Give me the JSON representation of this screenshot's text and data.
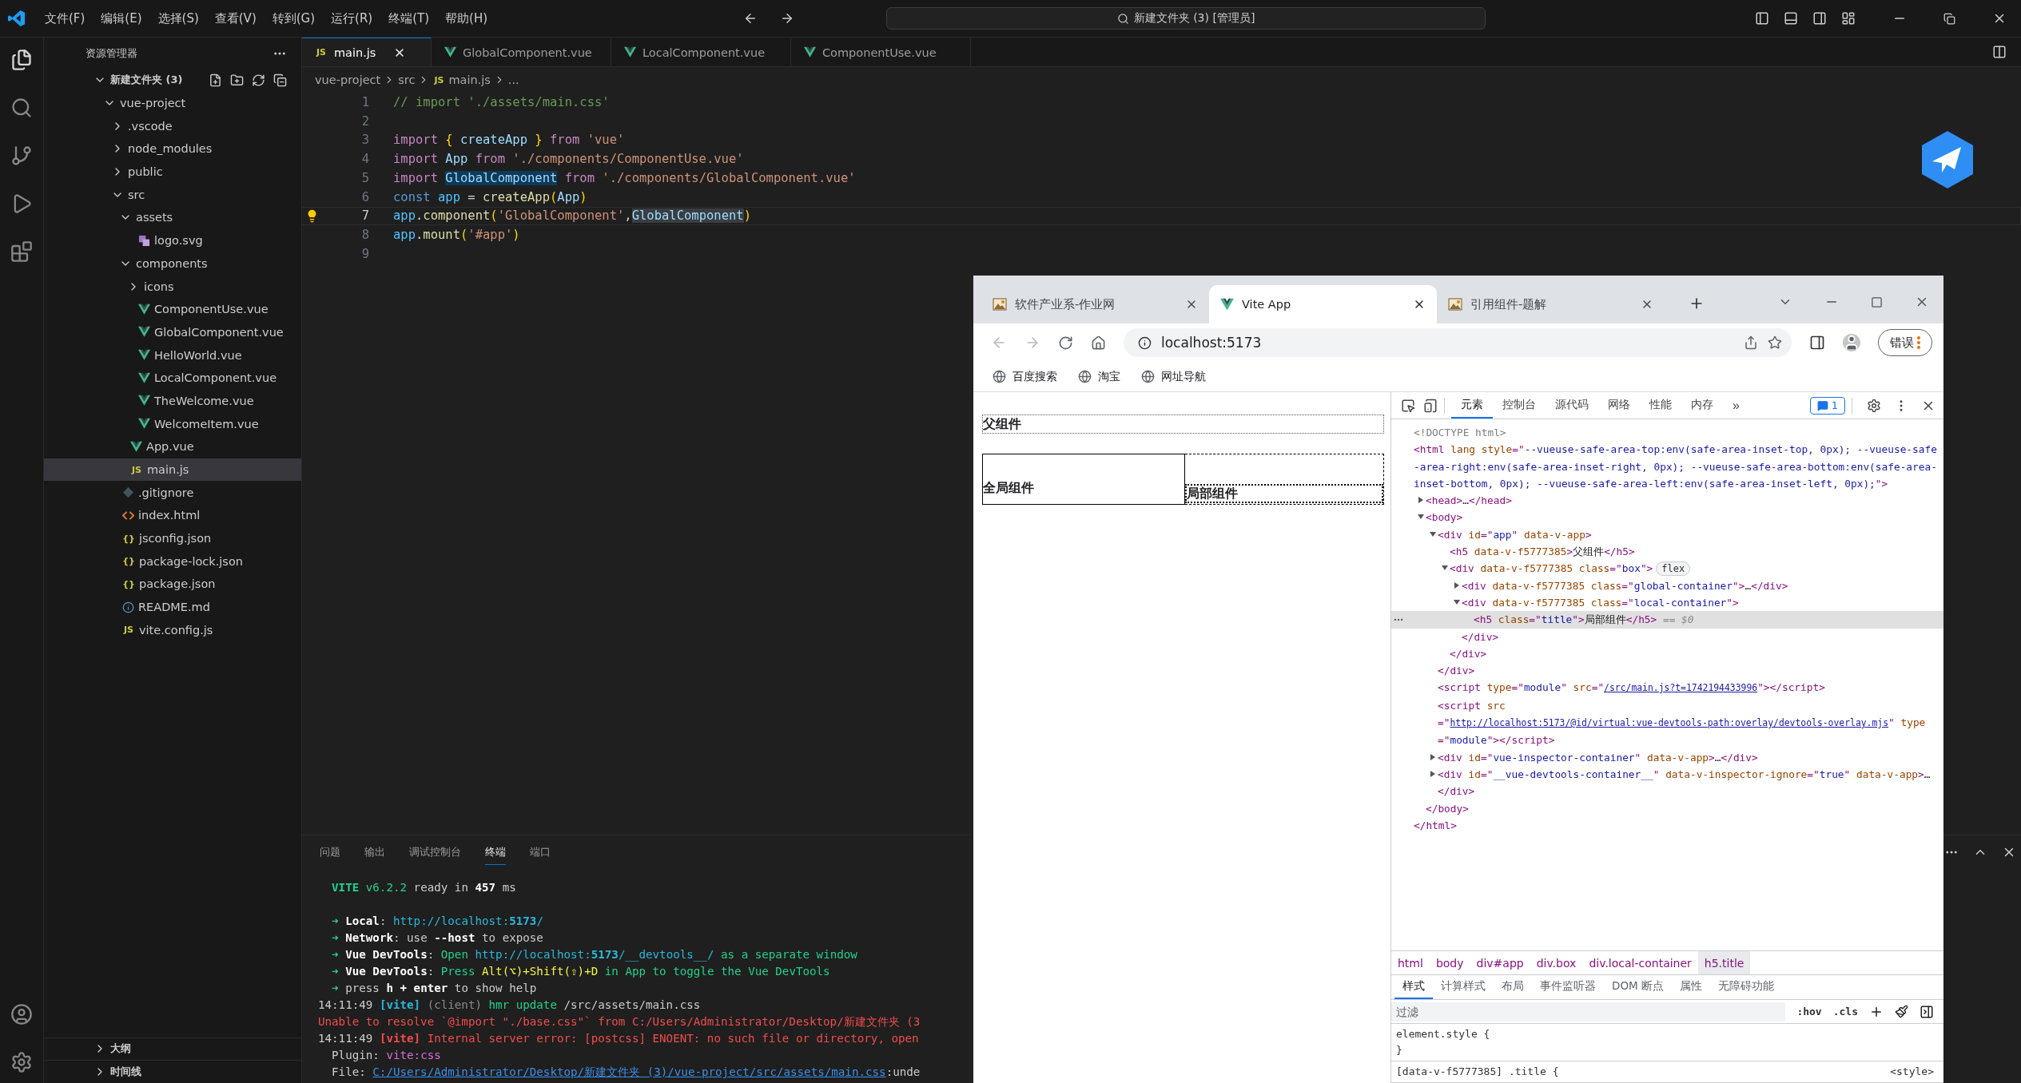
{
  "menu_bar": {
    "items": [
      "文件(F)",
      "编辑(E)",
      "选择(S)",
      "查看(V)",
      "转到(G)",
      "运行(R)",
      "终端(T)",
      "帮助(H)"
    ],
    "search": "新建文件夹 (3) [管理员]"
  },
  "explorer": {
    "title": "资源管理器",
    "section": {
      "label": "新建文件夹 (3)",
      "expanded": true
    },
    "tree": [
      {
        "label": "vue-project",
        "kind": "folder",
        "expanded": true,
        "selected": false,
        "children": [
          {
            "label": ".vscode",
            "kind": "folder",
            "expanded": false,
            "selected": false
          },
          {
            "label": "node_modules",
            "kind": "folder",
            "expanded": false,
            "selected": false
          },
          {
            "label": "public",
            "kind": "folder",
            "expanded": false,
            "selected": false
          },
          {
            "label": "src",
            "kind": "folder",
            "expanded": true,
            "selected": false,
            "children": [
              {
                "label": "assets",
                "kind": "folder",
                "expanded": true,
                "selected": false,
                "children": [
                  {
                    "label": "logo.svg",
                    "kind": "svg",
                    "selected": false
                  }
                ]
              },
              {
                "label": "components",
                "kind": "folder",
                "expanded": true,
                "selected": false,
                "children": [
                  {
                    "label": "icons",
                    "kind": "folder",
                    "expanded": false,
                    "selected": false
                  },
                  {
                    "label": "ComponentUse.vue",
                    "kind": "vue",
                    "selected": false
                  },
                  {
                    "label": "GlobalComponent.vue",
                    "kind": "vue",
                    "selected": false
                  },
                  {
                    "label": "HelloWorld.vue",
                    "kind": "vue",
                    "selected": false
                  },
                  {
                    "label": "LocalComponent.vue",
                    "kind": "vue",
                    "selected": false
                  },
                  {
                    "label": "TheWelcome.vue",
                    "kind": "vue",
                    "selected": false
                  },
                  {
                    "label": "WelcomeItem.vue",
                    "kind": "vue",
                    "selected": false
                  }
                ]
              },
              {
                "label": "App.vue",
                "kind": "vue",
                "selected": false
              },
              {
                "label": "main.js",
                "kind": "js",
                "icon_text": "JS",
                "selected": true
              }
            ]
          },
          {
            "label": ".gitignore",
            "kind": "git",
            "selected": false
          },
          {
            "label": "index.html",
            "kind": "html",
            "selected": false
          },
          {
            "label": "jsconfig.json",
            "kind": "json",
            "icon_text": "{}",
            "selected": false
          },
          {
            "label": "package-lock.json",
            "kind": "json",
            "icon_text": "{}",
            "selected": false
          },
          {
            "label": "package.json",
            "kind": "json",
            "icon_text": "{}",
            "selected": false
          },
          {
            "label": "README.md",
            "kind": "info",
            "selected": false
          },
          {
            "label": "vite.config.js",
            "kind": "js",
            "icon_text": "JS",
            "selected": false
          }
        ]
      }
    ],
    "bottom_sections": [
      {
        "label": "大纲",
        "expanded": false
      },
      {
        "label": "时间线",
        "expanded": false
      }
    ]
  },
  "editor": {
    "tabs": [
      {
        "label": "main.js",
        "kind": "js",
        "icon_text": "JS",
        "selected": true
      },
      {
        "label": "GlobalComponent.vue",
        "kind": "vue",
        "selected": false
      },
      {
        "label": "LocalComponent.vue",
        "kind": "vue",
        "selected": false
      },
      {
        "label": "ComponentUse.vue",
        "kind": "vue",
        "selected": false
      }
    ],
    "breadcrumb": [
      {
        "label": "vue-project"
      },
      {
        "label": "src"
      },
      {
        "label": "main.js",
        "icon_text": "JS"
      },
      {
        "label": "..."
      }
    ],
    "lines": [
      {
        "number": "1",
        "current": false,
        "tokens": [
          {
            "kind": "comment",
            "text": "// import './assets/main.css'"
          }
        ]
      },
      {
        "number": "2",
        "current": false
      },
      {
        "number": "3",
        "current": false,
        "tokens": [
          {
            "kind": "keyword",
            "text": "import "
          },
          {
            "kind": "bracket",
            "text": "{"
          },
          {
            "kind": "var",
            "text": " createApp "
          },
          {
            "kind": "bracket",
            "text": "}"
          },
          {
            "kind": "keyword",
            "text": " from "
          },
          {
            "kind": "string",
            "text": "'vue'"
          }
        ]
      },
      {
        "number": "4",
        "current": false,
        "tokens": [
          {
            "kind": "keyword",
            "text": "import "
          },
          {
            "kind": "var",
            "text": "App"
          },
          {
            "kind": "keyword",
            "text": " from "
          },
          {
            "kind": "string",
            "text": "'./components/ComponentUse.vue'"
          }
        ]
      },
      {
        "number": "5",
        "current": false,
        "tokens": [
          {
            "kind": "keyword",
            "text": "import "
          },
          {
            "kind": "var_match",
            "text": "GlobalComponent"
          },
          {
            "kind": "keyword",
            "text": " from "
          },
          {
            "kind": "string",
            "text": "'./components/GlobalComponent.vue'"
          }
        ]
      },
      {
        "number": "6",
        "current": false,
        "tokens": [
          {
            "kind": "storage",
            "text": "const "
          },
          {
            "kind": "const",
            "text": "app"
          },
          {
            "kind": "plain",
            "text": " = "
          },
          {
            "kind": "func",
            "text": "createApp"
          },
          {
            "kind": "bracket",
            "text": "("
          },
          {
            "kind": "var",
            "text": "App"
          },
          {
            "kind": "bracket",
            "text": ")"
          }
        ]
      },
      {
        "number": "7",
        "current": true,
        "tokens": [
          {
            "kind": "const",
            "text": "app"
          },
          {
            "kind": "plain",
            "text": "."
          },
          {
            "kind": "func",
            "text": "component"
          },
          {
            "kind": "bracket",
            "text": "("
          },
          {
            "kind": "string",
            "text": "'GlobalComponent'"
          },
          {
            "kind": "plain",
            "text": ","
          },
          {
            "kind": "var_selected",
            "text": "GlobalComponent"
          },
          {
            "kind": "bracket",
            "text": ")"
          }
        ]
      },
      {
        "number": "8",
        "current": false,
        "tokens": [
          {
            "kind": "const",
            "text": "app"
          },
          {
            "kind": "plain",
            "text": "."
          },
          {
            "kind": "func",
            "text": "mount"
          },
          {
            "kind": "bracket",
            "text": "("
          },
          {
            "kind": "string",
            "text": "'#app'"
          },
          {
            "kind": "bracket",
            "text": ")"
          }
        ]
      },
      {
        "number": "9",
        "current": false
      }
    ]
  },
  "panel": {
    "tabs": [
      {
        "label": "问题",
        "selected": false
      },
      {
        "label": "输出",
        "selected": false
      },
      {
        "label": "调试控制台",
        "selected": false
      },
      {
        "label": "终端",
        "selected": true
      },
      {
        "label": "端口",
        "selected": false
      }
    ],
    "terminal": [
      [
        {
          "indented": true,
          "tokens": [
            {
              "kind": "title",
              "text": "VITE"
            },
            {
              "kind": "green",
              "text": " v6.2.2"
            },
            {
              "kind": "plain",
              "text": "  ready in "
            },
            {
              "kind": "bold",
              "text": "457"
            },
            {
              "kind": "plain",
              "text": " ms"
            }
          ]
        }
      ],
      [
        {
          "indented": true,
          "tokens": [
            {
              "kind": "arrow",
              "text": "➜  "
            },
            {
              "kind": "bold",
              "text": "Local"
            },
            {
              "kind": "plain",
              "text": ":   "
            },
            {
              "kind": "link",
              "text": "http://localhost:**5173**/"
            }
          ]
        },
        {
          "indented": true,
          "tokens": [
            {
              "kind": "arrow",
              "text": "➜  "
            },
            {
              "kind": "bold",
              "text": "Network"
            },
            {
              "kind": "plain",
              "text": ": use "
            },
            {
              "kind": "bold",
              "text": "--host"
            },
            {
              "kind": "plain",
              "text": " to expose"
            }
          ]
        },
        {
          "indented": true,
          "tokens": [
            {
              "kind": "arrow",
              "text": "➜  "
            },
            {
              "kind": "bold",
              "text": "Vue DevTools"
            },
            {
              "kind": "plain",
              "text": ": "
            },
            {
              "kind": "green",
              "text": "Open "
            },
            {
              "kind": "link",
              "text": "http://localhost:**5173**/__devtools__/"
            },
            {
              "kind": "green",
              "text": " as a separate window"
            }
          ]
        },
        {
          "indented": true,
          "tokens": [
            {
              "kind": "arrow",
              "text": "➜  "
            },
            {
              "kind": "bold",
              "text": "Vue DevTools"
            },
            {
              "kind": "plain",
              "text": ": "
            },
            {
              "kind": "green",
              "text": "Press "
            },
            {
              "kind": "yellow",
              "text": "Alt(⌥)+Shift(⇧)+D"
            },
            {
              "kind": "green",
              "text": " in App to toggle the Vue DevTools"
            }
          ]
        },
        {
          "indented": true,
          "tokens": [
            {
              "kind": "arrow",
              "text": "➜  "
            },
            {
              "kind": "plain",
              "text": "press "
            },
            {
              "kind": "bold",
              "text": "h + enter"
            },
            {
              "kind": "plain",
              "text": " to show help"
            }
          ]
        },
        {
          "indented": false,
          "tokens": [
            {
              "kind": "plain",
              "text": "14:11:49 "
            },
            {
              "kind": "tag",
              "text": "[vite]"
            },
            {
              "kind": "muted",
              "text": " (client)"
            },
            {
              "kind": "green",
              "text": " hmr update "
            },
            {
              "kind": "plain",
              "text": "/src/assets/main.css"
            }
          ]
        },
        {
          "indented": false,
          "tokens": [
            {
              "kind": "error",
              "text": "Unable to resolve `@import \"./base.css\"` from C:/Users/Administrator/Desktop/新建文件夹 (3"
            }
          ]
        },
        {
          "indented": false,
          "tokens": [
            {
              "kind": "plain",
              "text": "14:11:49 "
            },
            {
              "kind": "error_tag",
              "text": "[vite]"
            },
            {
              "kind": "error",
              "text": " Internal server error: [postcss] ENOENT: no such file or directory, open"
            }
          ]
        },
        {
          "indented": true,
          "tokens": [
            {
              "kind": "plain",
              "text": "Plugin: "
            },
            {
              "kind": "purple",
              "text": "vite:css"
            }
          ]
        },
        {
          "indented": true,
          "tokens": [
            {
              "kind": "plain",
              "text": "File: "
            },
            {
              "kind": "path",
              "text": "C:/Users/Administrator/Desktop/新建文件夹 (3)/vue-project/src/assets/main.css"
            },
            {
              "kind": "plain",
              "text": ":unde"
            }
          ]
        }
      ]
    ]
  },
  "browser": {
    "tabs": [
      {
        "label": "软件产业系-作业网",
        "kind": "image",
        "selected": false
      },
      {
        "label": "Vite App",
        "kind": "vue",
        "selected": true
      },
      {
        "label": "引用组件-题解",
        "kind": "image",
        "selected": false
      }
    ],
    "address": "localhost:5173",
    "profile_button": "错误",
    "bookmarks": [
      "百度搜索",
      "淘宝",
      "网址导航"
    ],
    "page": {
      "parent_title": "父组件",
      "global_title": "全局组件",
      "local_title": "局部组件"
    },
    "devtools": {
      "tabs": [
        {
          "label": "元素",
          "selected": true
        },
        {
          "label": "控制台",
          "selected": false
        },
        {
          "label": "源代码",
          "selected": false
        },
        {
          "label": "网络",
          "selected": false
        },
        {
          "label": "性能",
          "selected": false
        },
        {
          "label": "内存",
          "selected": false
        }
      ],
      "overflow": "»",
      "issues": "1",
      "dom": [
        {
          "selected": false,
          "tokens": [
            {
              "kind": "doctype",
              "text": "<!DOCTYPE html>"
            }
          ]
        },
        {
          "selected": false,
          "tokens": [
            {
              "kind": "tag",
              "text": "<html"
            },
            {
              "kind": "attr",
              "text": " lang style"
            },
            {
              "kind": "tag",
              "text": "=\""
            },
            {
              "kind": "value",
              "text": "--vueuse-safe-area-top:env(safe-area-inset-top, 0px); --vueuse-safe-area-right:env(safe-area-inset-right, 0px); --vueuse-safe-area-bottom:env(safe-area-inset-bottom, 0px); --vueuse-safe-area-left:env(safe-area-inset-left, 0px);"
            },
            {
              "kind": "tag",
              "text": "\">"
            }
          ],
          "close": "</html>",
          "children": [
            {
              "selected": false,
              "expanded": false,
              "tokens": [
                {
                  "kind": "tag",
                  "text": "<head>"
                },
                {
                  "kind": "text",
                  "text": "…"
                },
                {
                  "kind": "tag",
                  "text": "</head>"
                }
              ]
            },
            {
              "selected": false,
              "expanded": true,
              "tokens": [
                {
                  "kind": "tag",
                  "text": "<body>"
                }
              ],
              "close": "</body>",
              "children": [
                {
                  "selected": false,
                  "expanded": true,
                  "tokens": [
                    {
                      "kind": "tag",
                      "text": "<div"
                    },
                    {
                      "kind": "attr",
                      "text": " id"
                    },
                    {
                      "kind": "tag",
                      "text": "=\""
                    },
                    {
                      "kind": "value",
                      "text": "app"
                    },
                    {
                      "kind": "tag",
                      "text": "\""
                    },
                    {
                      "kind": "attr",
                      "text": " data-v-app"
                    },
                    {
                      "kind": "tag",
                      "text": ">"
                    }
                  ],
                  "close": "</div>",
                  "children": [
                    {
                      "selected": false,
                      "tokens": [
                        {
                          "kind": "tag",
                          "text": "<h5"
                        },
                        {
                          "kind": "attr",
                          "text": " data-v-f5777385"
                        },
                        {
                          "kind": "tag",
                          "text": ">"
                        },
                        {
                          "kind": "text",
                          "text": "父组件"
                        },
                        {
                          "kind": "tag",
                          "text": "</h5>"
                        }
                      ]
                    },
                    {
                      "selected": false,
                      "expanded": true,
                      "tokens": [
                        {
                          "kind": "tag",
                          "text": "<div"
                        },
                        {
                          "kind": "attr",
                          "text": " data-v-f5777385 class"
                        },
                        {
                          "kind": "tag",
                          "text": "=\""
                        },
                        {
                          "kind": "value",
                          "text": "box"
                        },
                        {
                          "kind": "tag",
                          "text": "\">"
                        },
                        {
                          "kind": "badge",
                          "text": "flex"
                        }
                      ],
                      "close": "</div>",
                      "children": [
                        {
                          "selected": false,
                          "expanded": false,
                          "tokens": [
                            {
                              "kind": "tag",
                              "text": "<div"
                            },
                            {
                              "kind": "attr",
                              "text": " data-v-f5777385 class"
                            },
                            {
                              "kind": "tag",
                              "text": "=\""
                            },
                            {
                              "kind": "value",
                              "text": "global-container"
                            },
                            {
                              "kind": "tag",
                              "text": "\">"
                            },
                            {
                              "kind": "text",
                              "text": "…"
                            },
                            {
                              "kind": "tag",
                              "text": "</div>"
                            }
                          ]
                        },
                        {
                          "selected": false,
                          "expanded": true,
                          "tokens": [
                            {
                              "kind": "tag",
                              "text": "<div"
                            },
                            {
                              "kind": "attr",
                              "text": " data-v-f5777385 class"
                            },
                            {
                              "kind": "tag",
                              "text": "=\""
                            },
                            {
                              "kind": "value",
                              "text": "local-container"
                            },
                            {
                              "kind": "tag",
                              "text": "\">"
                            }
                          ],
                          "close": "</div>",
                          "children": [
                            {
                              "selected": true,
                              "tokens": [
                                {
                                  "kind": "tag",
                                  "text": "<h5"
                                },
                                {
                                  "kind": "attr",
                                  "text": " class"
                                },
                                {
                                  "kind": "tag",
                                  "text": "=\""
                                },
                                {
                                  "kind": "value",
                                  "text": "title"
                                },
                                {
                                  "kind": "tag",
                                  "text": "\">"
                                },
                                {
                                  "kind": "text",
                                  "text": "局部组件"
                                },
                                {
                                  "kind": "tag",
                                  "text": "</h5>"
                                },
                                {
                                  "kind": "marker",
                                  "text": " == $0"
                                }
                              ]
                            }
                          ]
                        }
                      ]
                    }
                  ]
                },
                {
                  "selected": false,
                  "tokens": [
                    {
                      "kind": "tag",
                      "text": "<script"
                    },
                    {
                      "kind": "attr",
                      "text": " type"
                    },
                    {
                      "kind": "tag",
                      "text": "=\""
                    },
                    {
                      "kind": "value",
                      "text": "module"
                    },
                    {
                      "kind": "tag",
                      "text": "\""
                    },
                    {
                      "kind": "attr",
                      "text": " src"
                    },
                    {
                      "kind": "tag",
                      "text": "=\""
                    },
                    {
                      "kind": "link",
                      "text": "/src/main.js?t=1742194433996"
                    },
                    {
                      "kind": "tag",
                      "text": "\"></script>"
                    }
                  ]
                },
                {
                  "selected": false,
                  "tokens": [
                    {
                      "kind": "tag",
                      "text": "<script"
                    },
                    {
                      "kind": "attr",
                      "text": " src"
                    },
                    {
                      "kind": "tag",
                      "text": "=\""
                    },
                    {
                      "kind": "link",
                      "text": "http://localhost:5173/@id/virtual:vue-devtools-path:overlay/devtools-overlay.mjs"
                    },
                    {
                      "kind": "tag",
                      "text": "\""
                    },
                    {
                      "kind": "attr",
                      "text": " type"
                    },
                    {
                      "kind": "tag",
                      "text": "=\""
                    },
                    {
                      "kind": "value",
                      "text": "module"
                    },
                    {
                      "kind": "tag",
                      "text": "\"></script>"
                    }
                  ]
                },
                {
                  "selected": false,
                  "expanded": false,
                  "tokens": [
                    {
                      "kind": "tag",
                      "text": "<div"
                    },
                    {
                      "kind": "attr",
                      "text": " id"
                    },
                    {
                      "kind": "tag",
                      "text": "=\""
                    },
                    {
                      "kind": "value",
                      "text": "vue-inspector-container"
                    },
                    {
                      "kind": "tag",
                      "text": "\""
                    },
                    {
                      "kind": "attr",
                      "text": " data-v-app"
                    },
                    {
                      "kind": "tag",
                      "text": ">"
                    },
                    {
                      "kind": "text",
                      "text": "…"
                    },
                    {
                      "kind": "tag",
                      "text": "</div>"
                    }
                  ]
                },
                {
                  "selected": false,
                  "expanded": false,
                  "tokens": [
                    {
                      "kind": "tag",
                      "text": "<div"
                    },
                    {
                      "kind": "attr",
                      "text": " id"
                    },
                    {
                      "kind": "tag",
                      "text": "=\""
                    },
                    {
                      "kind": "value",
                      "text": "__vue-devtools-container__"
                    },
                    {
                      "kind": "tag",
                      "text": "\""
                    },
                    {
                      "kind": "attr",
                      "text": " data-v-inspector-ignore"
                    },
                    {
                      "kind": "tag",
                      "text": "=\""
                    },
                    {
                      "kind": "value",
                      "text": "true"
                    },
                    {
                      "kind": "tag",
                      "text": "\""
                    },
                    {
                      "kind": "attr",
                      "text": " data-v-app"
                    },
                    {
                      "kind": "tag",
                      "text": ">"
                    },
                    {
                      "kind": "text",
                      "text": "…"
                    },
                    {
                      "kind": "tag",
                      "text": "</div>"
                    }
                  ]
                }
              ]
            }
          ]
        }
      ],
      "breadcrumb": [
        {
          "label": "html",
          "selected": false
        },
        {
          "label": "body",
          "selected": false
        },
        {
          "label": "div#app",
          "selected": false
        },
        {
          "label": "div.box",
          "selected": false
        },
        {
          "label": "div.local-container",
          "selected": false
        },
        {
          "label": "h5.title",
          "selected": true
        }
      ],
      "style_tabs": [
        {
          "label": "样式",
          "selected": true
        },
        {
          "label": "计算样式",
          "selected": false
        },
        {
          "label": "布局",
          "selected": false
        },
        {
          "label": "事件监听器",
          "selected": false
        },
        {
          "label": "DOM 断点",
          "selected": false
        },
        {
          "label": "属性",
          "selected": false
        },
        {
          "label": "无障碍功能",
          "selected": false
        }
      ],
      "filter": {
        "placeholder": "过滤",
        "hov": ":hov",
        "cls": ".cls"
      },
      "rules": [
        {
          "lines": [
            "element.style {",
            "}"
          ]
        },
        {
          "lines": [
            "[data-v-f5777385] .title {"
          ],
          "source": "<style>"
        }
      ]
    }
  }
}
